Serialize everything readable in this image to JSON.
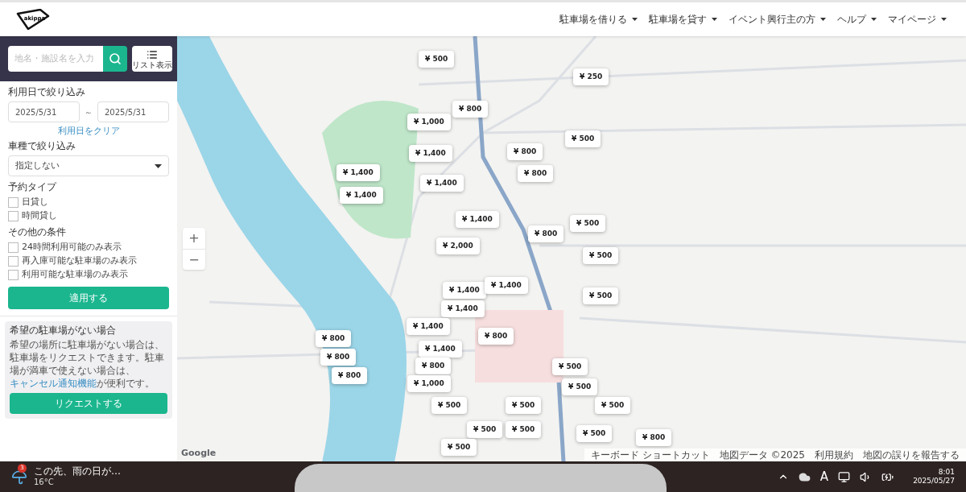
{
  "header": {
    "logo": "akippa",
    "nav": [
      "駐車場を借りる",
      "駐車場を貸す",
      "イベント興行主の方",
      "ヘルプ",
      "マイページ"
    ]
  },
  "search": {
    "placeholder": "地名・施設名を入力",
    "list_button": "リスト表示"
  },
  "date_filter": {
    "title": "利用日で絞り込み",
    "from": "2025/5/31",
    "separator": "～",
    "to": "2025/5/31",
    "clear_link": "利用日をクリア"
  },
  "vehicle_filter": {
    "title": "車種で絞り込み",
    "value": "指定しない"
  },
  "reservation_type": {
    "title": "予約タイプ",
    "options": [
      {
        "label": "日貸し",
        "checked": false
      },
      {
        "label": "時間貸し",
        "checked": false
      }
    ]
  },
  "other_conditions": {
    "title": "その他の条件",
    "options": [
      {
        "label": "24時間利用可能のみ表示",
        "checked": false
      },
      {
        "label": "再入庫可能な駐車場のみ表示",
        "checked": false
      },
      {
        "label": "利用可能な駐車場のみ表示",
        "checked": false
      }
    ]
  },
  "apply_button": "適用する",
  "request_box": {
    "title": "希望の駐車場がない場合",
    "text": "希望の場所に駐車場がない場合は、駐車場をリクエストできます。駐車場が満車で使えない場合は、",
    "link": "キャンセル通知機能",
    "text_after": "が便利です。",
    "button": "リクエストする"
  },
  "map": {
    "pins": [
      {
        "price": "¥ 500"
      },
      {
        "price": "¥ 250"
      },
      {
        "price": "¥ 800"
      },
      {
        "price": "¥ 1,000"
      },
      {
        "price": "¥ 500"
      },
      {
        "price": "¥ 1,400"
      },
      {
        "price": "¥ 800"
      },
      {
        "price": "¥ 1,400"
      },
      {
        "price": "¥ 800"
      },
      {
        "price": "¥ 1,400"
      },
      {
        "price": "¥ 1,400"
      },
      {
        "price": "¥ 1,400"
      },
      {
        "price": "¥ 500"
      },
      {
        "price": "¥ 800"
      },
      {
        "price": "¥ 2,000"
      },
      {
        "price": "¥ 500"
      },
      {
        "price": "¥ 1,400"
      },
      {
        "price": "¥ 1,400"
      },
      {
        "price": "¥ 500"
      },
      {
        "price": "¥ 1,400"
      },
      {
        "price": "¥ 1,400"
      },
      {
        "price": "¥ 800"
      },
      {
        "price": "¥ 800"
      },
      {
        "price": "¥ 1,400"
      },
      {
        "price": "¥ 800"
      },
      {
        "price": "¥ 800"
      },
      {
        "price": "¥ 500"
      },
      {
        "price": "¥ 800"
      },
      {
        "price": "¥ 1,000"
      },
      {
        "price": "¥ 500"
      },
      {
        "price": "¥ 500"
      },
      {
        "price": "¥ 500"
      },
      {
        "price": "¥ 500"
      },
      {
        "price": "¥ 500"
      },
      {
        "price": "¥ 500"
      },
      {
        "price": "¥ 500"
      },
      {
        "price": "¥ 500"
      },
      {
        "price": "¥ 800"
      }
    ],
    "zoom_in": "+",
    "zoom_out": "−",
    "logo": "Google",
    "footer": [
      "キーボード ショートカット",
      "地図データ ©2025",
      "利用規約",
      "地図の誤りを報告する"
    ]
  },
  "taskbar": {
    "weather": {
      "badge": "3",
      "text": "この先、雨の日が…",
      "temp": "16°C"
    },
    "ime": "A",
    "time": "8:01",
    "date": "2025/05/27"
  }
}
